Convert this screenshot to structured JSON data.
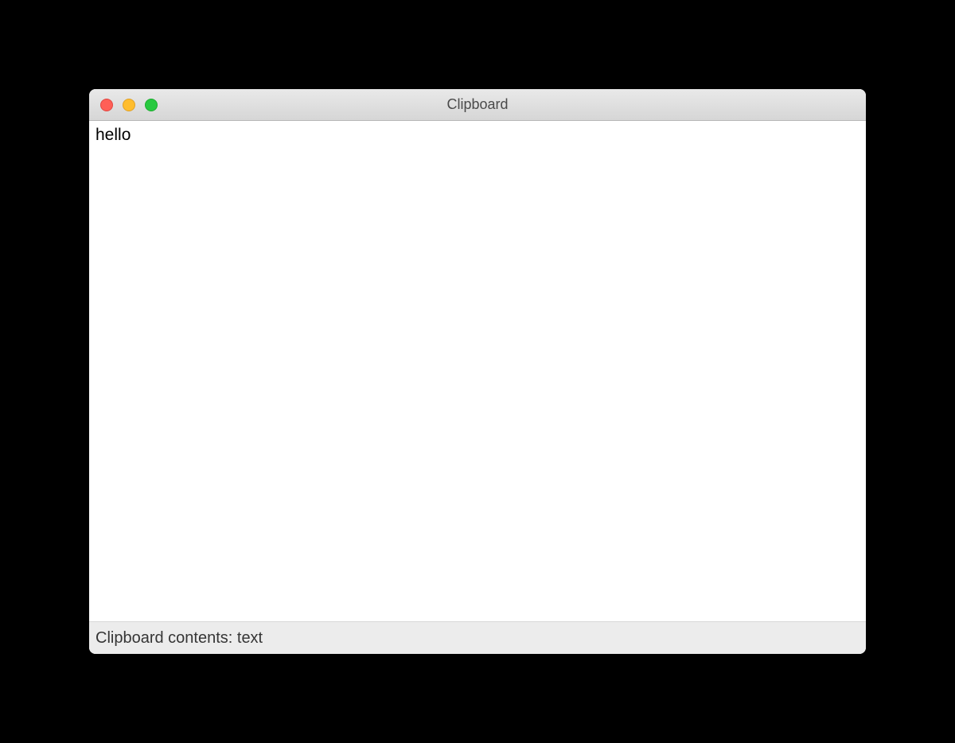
{
  "window": {
    "title": "Clipboard"
  },
  "content": {
    "text": "hello"
  },
  "status": {
    "label": "Clipboard contents: text"
  }
}
